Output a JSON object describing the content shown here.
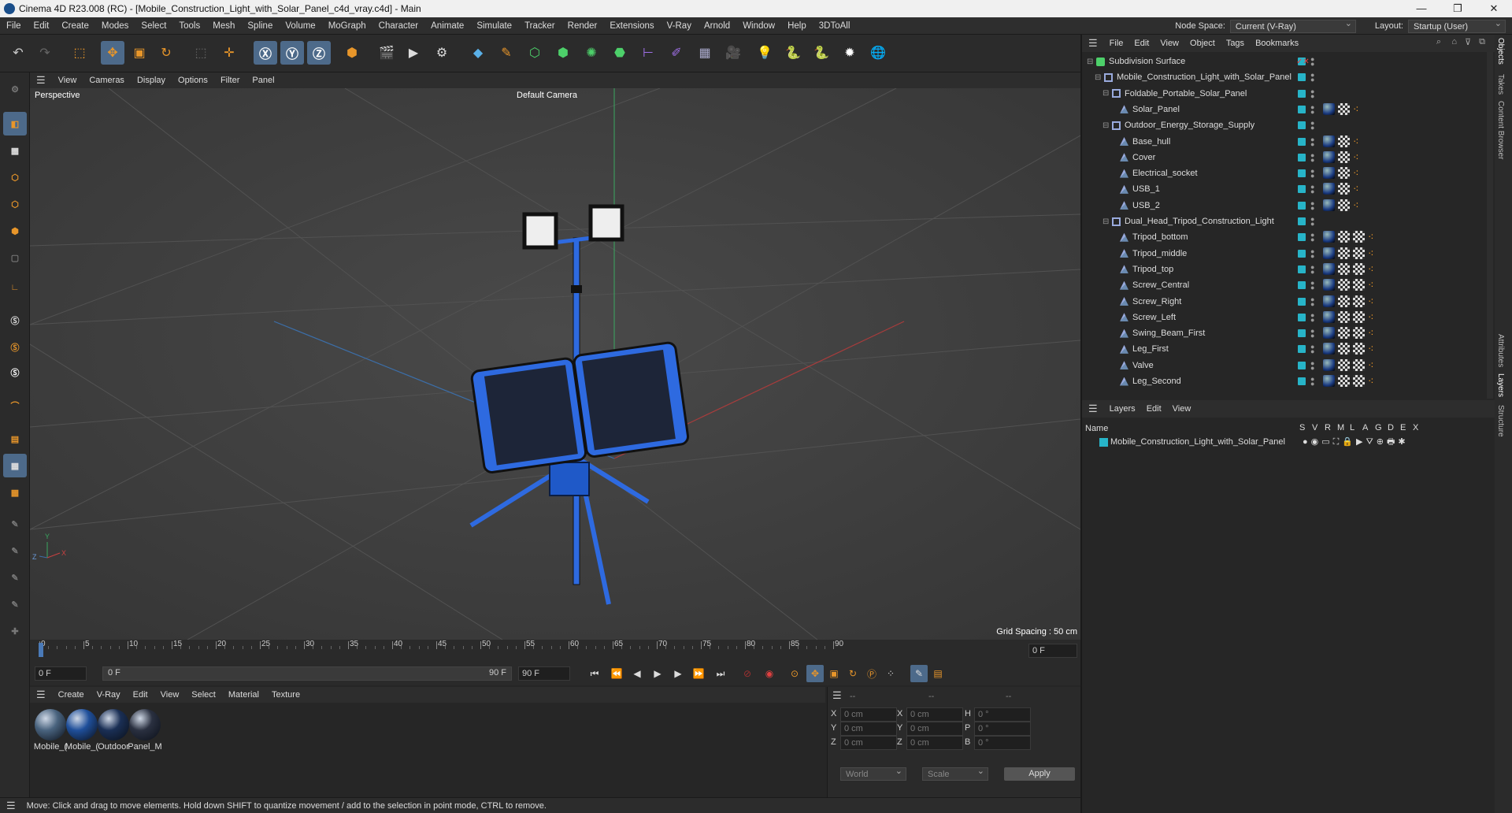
{
  "window": {
    "title": "Cinema 4D R23.008 (RC) - [Mobile_Construction_Light_with_Solar_Panel_c4d_vray.c4d] - Main",
    "minimize": "—",
    "maximize": "❐",
    "close": "✕"
  },
  "menu": [
    "File",
    "Edit",
    "Create",
    "Modes",
    "Select",
    "Tools",
    "Mesh",
    "Spline",
    "Volume",
    "MoGraph",
    "Character",
    "Animate",
    "Simulate",
    "Tracker",
    "Render",
    "Extensions",
    "V-Ray",
    "Arnold",
    "Window",
    "Help",
    "3DToAll"
  ],
  "nodespace": {
    "label": "Node Space:",
    "value": "Current (V-Ray)"
  },
  "layout": {
    "label": "Layout:",
    "value": "Startup (User)"
  },
  "viewport": {
    "menu": [
      "View",
      "Cameras",
      "Display",
      "Options",
      "Filter",
      "Panel"
    ],
    "label": "Perspective",
    "camera": "Default Camera",
    "grid_spacing": "Grid Spacing : 50 cm"
  },
  "timeline": {
    "ticks": [
      "0",
      "5",
      "10",
      "15",
      "20",
      "25",
      "30",
      "35",
      "40",
      "45",
      "50",
      "55",
      "60",
      "65",
      "70",
      "75",
      "80",
      "85",
      "90"
    ],
    "end_frame": "0 F"
  },
  "transport": {
    "start": "0 F",
    "current": "0 F",
    "range_end": "90 F",
    "end": "90 F"
  },
  "materials": {
    "menu": [
      "Create",
      "V-Ray",
      "Edit",
      "View",
      "Select",
      "Material",
      "Texture"
    ],
    "items": [
      {
        "name": "Mobile_(",
        "color": "#49637e"
      },
      {
        "name": "Mobile_(",
        "color": "#1f4f9a"
      },
      {
        "name": "Outdoor",
        "color": "#1a2f55"
      },
      {
        "name": "Panel_M",
        "color": "#2a3040"
      }
    ]
  },
  "coords": {
    "headers": [
      "--",
      "--",
      "--"
    ],
    "rows": [
      {
        "a": "X",
        "av": "0 cm",
        "b": "X",
        "bv": "0 cm",
        "c": "H",
        "cv": "0 °"
      },
      {
        "a": "Y",
        "av": "0 cm",
        "b": "Y",
        "bv": "0 cm",
        "c": "P",
        "cv": "0 °"
      },
      {
        "a": "Z",
        "av": "0 cm",
        "b": "Z",
        "bv": "0 cm",
        "c": "B",
        "cv": "0 °"
      }
    ],
    "world": "World",
    "scale": "Scale",
    "apply": "Apply"
  },
  "status": "Move: Click and drag to move elements. Hold down SHIFT to quantize movement / add to the selection in point mode, CTRL to remove.",
  "objects": {
    "menu": [
      "File",
      "Edit",
      "View",
      "Object",
      "Tags",
      "Bookmarks"
    ],
    "items": [
      {
        "name": "Subdivision Surface",
        "level": 0,
        "type": "subd"
      },
      {
        "name": "Mobile_Construction_Light_with_Solar_Panel",
        "level": 1,
        "type": "null"
      },
      {
        "name": "Foldable_Portable_Solar_Panel",
        "level": 2,
        "type": "null"
      },
      {
        "name": "Solar_Panel",
        "level": 3,
        "type": "mesh",
        "tags": 2
      },
      {
        "name": "Outdoor_Energy_Storage_Supply",
        "level": 2,
        "type": "null"
      },
      {
        "name": "Base_hull",
        "level": 3,
        "type": "mesh",
        "tags": 2
      },
      {
        "name": "Cover",
        "level": 3,
        "type": "mesh",
        "tags": 2
      },
      {
        "name": "Electrical_socket",
        "level": 3,
        "type": "mesh",
        "tags": 2
      },
      {
        "name": "USB_1",
        "level": 3,
        "type": "mesh",
        "tags": 2
      },
      {
        "name": "USB_2",
        "level": 3,
        "type": "mesh",
        "tags": 2
      },
      {
        "name": "Dual_Head_Tripod_Construction_Light",
        "level": 2,
        "type": "null"
      },
      {
        "name": "Tripod_bottom",
        "level": 3,
        "type": "mesh",
        "tags": 3
      },
      {
        "name": "Tripod_middle",
        "level": 3,
        "type": "mesh",
        "tags": 3
      },
      {
        "name": "Tripod_top",
        "level": 3,
        "type": "mesh",
        "tags": 3
      },
      {
        "name": "Screw_Central",
        "level": 3,
        "type": "mesh",
        "tags": 3
      },
      {
        "name": "Screw_Right",
        "level": 3,
        "type": "mesh",
        "tags": 3
      },
      {
        "name": "Screw_Left",
        "level": 3,
        "type": "mesh",
        "tags": 3
      },
      {
        "name": "Swing_Beam_First",
        "level": 3,
        "type": "mesh",
        "tags": 3
      },
      {
        "name": "Leg_First",
        "level": 3,
        "type": "mesh",
        "tags": 3
      },
      {
        "name": "Valve",
        "level": 3,
        "type": "mesh",
        "tags": 3
      },
      {
        "name": "Leg_Second",
        "level": 3,
        "type": "mesh",
        "tags": 3
      }
    ]
  },
  "layers": {
    "menu": [
      "Layers",
      "Edit",
      "View"
    ],
    "name_col": "Name",
    "cols": [
      "S",
      "V",
      "R",
      "M",
      "L",
      "A",
      "G",
      "D",
      "E",
      "X"
    ],
    "row": "Mobile_Construction_Light_with_Solar_Panel"
  },
  "side_tabs": [
    "Objects",
    "Takes",
    "Content Browser",
    "Attributes",
    "Layers",
    "Structure"
  ]
}
